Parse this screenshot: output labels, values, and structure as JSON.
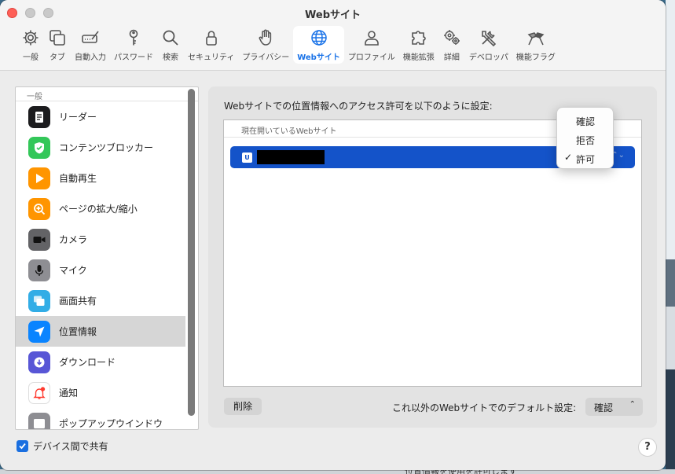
{
  "window": {
    "title": "Webサイト"
  },
  "toolbar": {
    "items": [
      {
        "label": "一般",
        "icon": "gear-icon"
      },
      {
        "label": "タブ",
        "icon": "tabs-icon"
      },
      {
        "label": "自動入力",
        "icon": "pen-field-icon"
      },
      {
        "label": "パスワード",
        "icon": "key-icon"
      },
      {
        "label": "検索",
        "icon": "magnifier-icon"
      },
      {
        "label": "セキュリティ",
        "icon": "lock-icon"
      },
      {
        "label": "プライバシー",
        "icon": "hand-icon"
      },
      {
        "label": "Webサイト",
        "icon": "globe-icon",
        "active": true
      },
      {
        "label": "プロファイル",
        "icon": "person-icon"
      },
      {
        "label": "機能拡張",
        "icon": "puzzle-icon"
      },
      {
        "label": "詳細",
        "icon": "gears-icon"
      },
      {
        "label": "デベロッパ",
        "icon": "tools-icon"
      },
      {
        "label": "機能フラグ",
        "icon": "flags-icon"
      }
    ]
  },
  "sidebar": {
    "section": "一般",
    "items": [
      {
        "label": "リーダー",
        "icon": "reader-icon",
        "color": "#1c1c1e"
      },
      {
        "label": "コンテンツブロッカー",
        "icon": "shield-check-icon",
        "color": "#33c759"
      },
      {
        "label": "自動再生",
        "icon": "play-icon",
        "color": "#ff9500"
      },
      {
        "label": "ページの拡大/縮小",
        "icon": "zoom-icon",
        "color": "#ff9500"
      },
      {
        "label": "カメラ",
        "icon": "camera-icon",
        "color": "#636366"
      },
      {
        "label": "マイク",
        "icon": "microphone-icon",
        "color": "#8e8e93"
      },
      {
        "label": "画面共有",
        "icon": "screen-share-icon",
        "color": "#32ade6"
      },
      {
        "label": "位置情報",
        "icon": "location-arrow-icon",
        "color": "#0a84ff",
        "selected": true
      },
      {
        "label": "ダウンロード",
        "icon": "download-icon",
        "color": "#5856d6"
      },
      {
        "label": "通知",
        "icon": "bell-icon",
        "color": "#ff3b30"
      },
      {
        "label": "ポップアップウインドウ",
        "icon": "popup-icon",
        "color": "#8e8e93"
      }
    ]
  },
  "share": {
    "label": "デバイス間で共有",
    "checked": true
  },
  "help": {
    "label": "?"
  },
  "panel": {
    "heading": "Webサイトでの位置情報へのアクセス許可を以下のように設定:",
    "table_header": "現在開いているWebサイト",
    "row": {
      "favicon_text": "U",
      "setting": "許可"
    },
    "delete_label": "削除",
    "default_label": "これ以外のWebサイトでのデフォルト設定:",
    "default_value": "確認"
  },
  "menu": {
    "options": [
      "確認",
      "拒否",
      "許可"
    ],
    "selected": "許可"
  },
  "background": {
    "text": "位置情報を使用を許可します"
  }
}
